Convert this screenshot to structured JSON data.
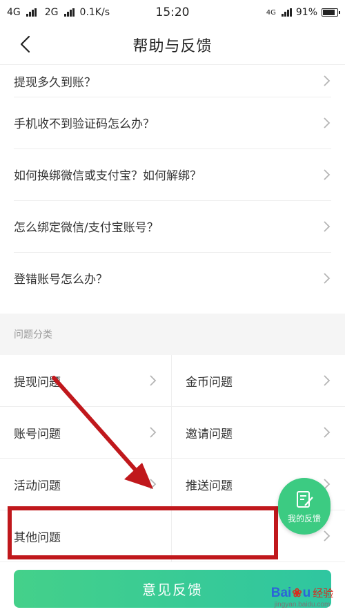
{
  "status_bar": {
    "network_1": "4G",
    "network_2": "2G",
    "speed": "0.1K/s",
    "time": "15:20",
    "network_right": "4G",
    "battery": "91%",
    "battery_level": 0.91
  },
  "header": {
    "title": "帮助与反馈",
    "back_icon": "chevron-left-icon"
  },
  "faq_items": [
    {
      "label": "提现多久到账？"
    },
    {
      "label": "手机收不到验证码怎么办？"
    },
    {
      "label": "如何换绑微信或支付宝？如何解绑？"
    },
    {
      "label": "怎么绑定微信/支付宝账号？"
    },
    {
      "label": "登错账号怎么办？"
    }
  ],
  "section_header": "问题分类",
  "categories": [
    {
      "label": "提现问题"
    },
    {
      "label": "金币问题"
    },
    {
      "label": "账号问题"
    },
    {
      "label": "邀请问题"
    },
    {
      "label": "活动问题"
    },
    {
      "label": "推送问题"
    },
    {
      "label": "其他问题"
    },
    {
      "label": ""
    }
  ],
  "floating_button": {
    "label": "我的反馈",
    "icon": "edit-note-icon",
    "color": "#3ccb82"
  },
  "feedback_button": {
    "label": "意见反馈"
  },
  "watermark": {
    "brand": "Bai",
    "brand_tail": "u",
    "product": "经验",
    "url": "jingyan.baidu.com"
  },
  "colors": {
    "accent_green": "#3ccb82",
    "annotation_red": "#c0181c"
  }
}
